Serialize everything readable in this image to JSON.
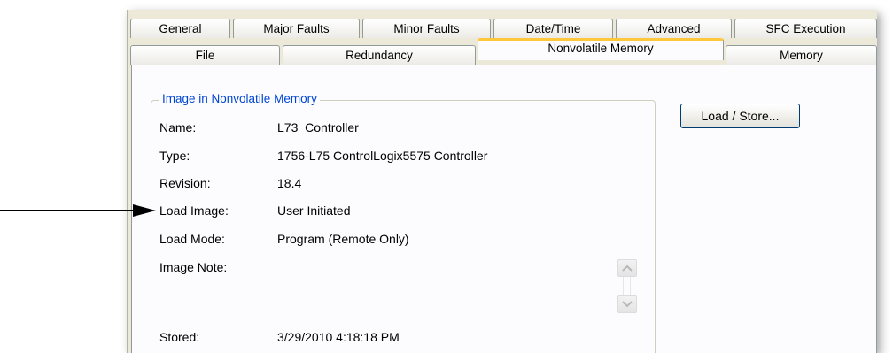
{
  "tabs_row1": [
    "General",
    "Major Faults",
    "Minor Faults",
    "Date/Time",
    "Advanced",
    "SFC Execution"
  ],
  "tabs_row2": [
    "File",
    "Redundancy",
    "Nonvolatile Memory",
    "Memory"
  ],
  "active_tab": "Nonvolatile Memory",
  "group": {
    "title": "Image in Nonvolatile Memory",
    "fields": {
      "name": {
        "label": "Name:",
        "value": "L73_Controller"
      },
      "type": {
        "label": "Type:",
        "value": "1756-L75 ControlLogix5575 Controller"
      },
      "revision": {
        "label": "Revision:",
        "value": "18.4"
      },
      "load_image": {
        "label": "Load Image:",
        "value": "User Initiated"
      },
      "load_mode": {
        "label": "Load Mode:",
        "value": "Program (Remote Only)"
      },
      "image_note": {
        "label": "Image Note:",
        "value": ""
      },
      "stored": {
        "label": "Stored:",
        "value": "3/29/2010  4:18:18 PM"
      }
    }
  },
  "buttons": {
    "load_store": "Load / Store..."
  },
  "icons": {
    "scroll_up": "scroll-up-icon",
    "scroll_down": "scroll-down-icon",
    "pointer_arrow": "arrow-right-icon"
  },
  "colors": {
    "window_bg": "#ece9d8",
    "panel_bg": "#fcfcfe",
    "group_title": "#0046d5",
    "active_tab_accent": "#ffc83c"
  }
}
